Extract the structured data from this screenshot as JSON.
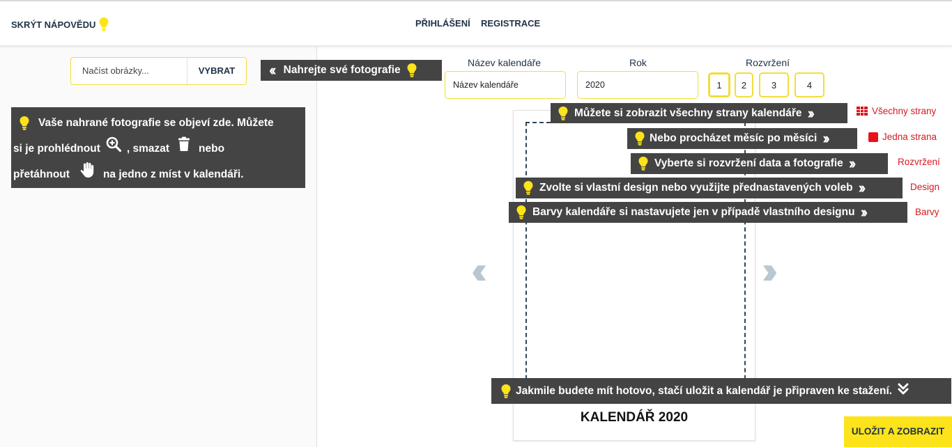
{
  "header": {
    "hide_help": "SKRÝT NÁPOVĚDU",
    "login": "PŘIHLÁŠENÍ",
    "register": "REGISTRACE"
  },
  "uploader": {
    "placeholder": "Načíst obrázky...",
    "choose_label": "VYBRAT"
  },
  "tips": {
    "upload": "Nahrejte své fotografie",
    "photos_line1": "Vaše nahrané fotografie se objeví zde. Můžete",
    "photos_line2a": "si je prohlédnout",
    "photos_line2b": ", smazat",
    "photos_line2c": "nebo",
    "photos_line3a": "přetáhnout",
    "photos_line3b": "na jedno z míst v kalendáři.",
    "all_pages": "Můžete si zobrazit všechny strany kalendáře",
    "month": "Nebo procházet měsíc po měsíci",
    "layout": "Vyberte si rozvržení data a fotografie",
    "design": "Zvolte si vlastní design nebo využijte přednastavených voleb",
    "colors": "Barvy kalendáře si nastavujete jen v případě vlastního designu",
    "save": "Jakmile budete mít hotovo, stačí uložit a kalendář je připraven ke stažení."
  },
  "form": {
    "name_label": "Název kalendáře",
    "name_value": "Název kalendáře",
    "year_label": "Rok",
    "year_value": "2020",
    "layout_label": "Rozvržení",
    "layout_options": [
      "1",
      "2",
      "3",
      "4"
    ],
    "layout_selected": "1"
  },
  "side_links": {
    "all_pages": "Všechny strany",
    "one_page": "Jedna strana",
    "layout": "Rozvržení",
    "design": "Design",
    "colors": "Barvy"
  },
  "calendar": {
    "title": "KALENDÁŘ 2020"
  },
  "actions": {
    "save": "ULOŽIT A ZOBRAZIT"
  },
  "colors": {
    "accent_yellow": "#fde31a",
    "tip_bg": "#444444",
    "link_red": "#d71920",
    "navy": "#1e3246"
  },
  "icons": {
    "bulb": "lightbulb-icon",
    "zoom": "zoom-in-icon",
    "delete": "trash-icon",
    "drag": "hand-icon",
    "prev": "double-chevron-left-icon",
    "next": "double-chevron-right-icon",
    "grid": "grid-icon",
    "page": "square-icon",
    "down": "double-chevron-down-icon"
  }
}
